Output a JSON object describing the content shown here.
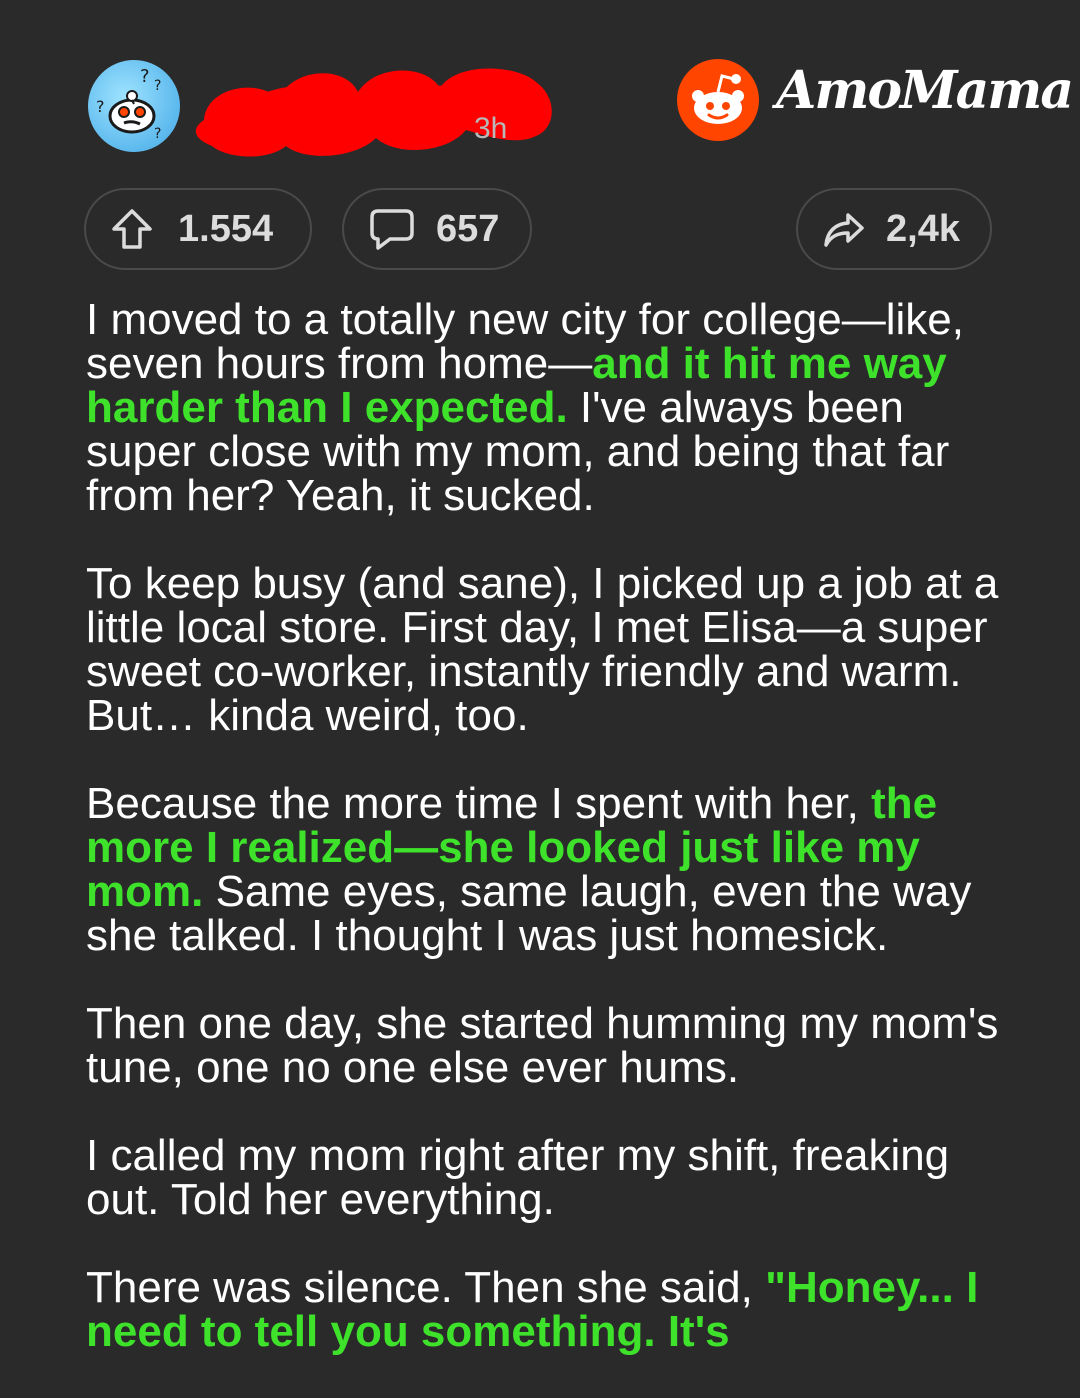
{
  "post": {
    "timestamp": "3h",
    "brand": "AmoMama"
  },
  "actions": {
    "upvotes": "1.554",
    "comments": "657",
    "shares": "2,4k"
  },
  "story": [
    [
      {
        "t": "I moved to a totally new city for college—like, seven hours from home—",
        "hl": false
      },
      {
        "t": "and it hit me way harder than I expected.",
        "hl": true
      },
      {
        "t": " I've always been super close with my mom, and being that far from her? Yeah, it sucked.",
        "hl": false
      }
    ],
    [
      {
        "t": "To keep busy (and sane), I picked up a job at a little local store. First day, I met Elisa—a super sweet co-worker, instantly friendly and warm. But… kinda weird, too.",
        "hl": false
      }
    ],
    [
      {
        "t": "Because the more time I spent with her, ",
        "hl": false
      },
      {
        "t": "the more I realized—she looked just like my mom.",
        "hl": true
      },
      {
        "t": " Same eyes, same laugh, even the way she talked. I thought I was just homesick.",
        "hl": false
      }
    ],
    [
      {
        "t": "Then one day, she started humming my mom's tune, one no one else ever hums.",
        "hl": false
      }
    ],
    [
      {
        "t": "I called my mom right after my shift, freaking out. Told her everything.",
        "hl": false
      }
    ],
    [
      {
        "t": "There was silence. Then she said, ",
        "hl": false
      },
      {
        "t": "\"Honey... I need to tell you something. It's",
        "hl": true
      }
    ]
  ],
  "colors": {
    "background": "#2a2a2a",
    "highlight": "#3ee22b",
    "reddit_orange": "#ff4500",
    "redaction": "#ff0000"
  },
  "icons": {
    "avatar": "reddit-snoo-confused-avatar",
    "brand_logo": "reddit-logo-icon",
    "upvote": "upvote-arrow-icon",
    "comment": "comment-bubble-icon",
    "share": "share-arrow-icon"
  }
}
